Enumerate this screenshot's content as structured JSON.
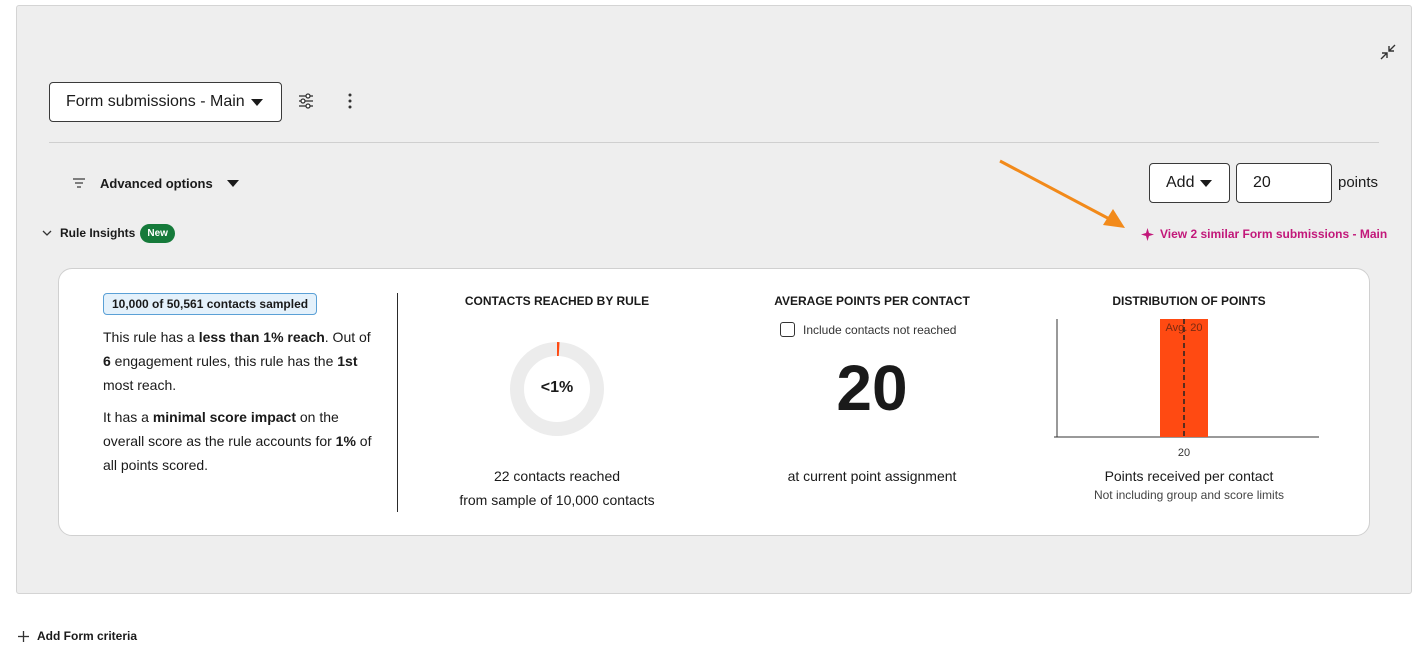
{
  "toolbar": {
    "rule_name": "Form submissions - Main"
  },
  "options": {
    "advanced_label": "Advanced options",
    "add_label": "Add",
    "points_value": "20",
    "points_label": "points"
  },
  "insights": {
    "toggle_label": "Rule Insights",
    "new_badge": "New",
    "similar_link": "View 2 similar Form submissions - Main"
  },
  "card": {
    "sampled_badge": "10,000 of 50,561 contacts sampled",
    "summary": {
      "p1_a": "This rule has a ",
      "p1_b": "less than 1% reach",
      "p1_c": ". Out of ",
      "p1_d": "6",
      "p1_e": " engagement rules, this rule has the ",
      "p1_f": "1st",
      "p1_g": " most reach.",
      "p2_a": "It has a ",
      "p2_b": "minimal score impact",
      "p2_c": " on the overall score as the rule accounts for ",
      "p2_d": "1%",
      "p2_e": " of all points scored."
    },
    "reach": {
      "title": "CONTACTS REACHED BY RULE",
      "donut_label": "<1%",
      "reach_fraction": 0.0022,
      "line1": "22 contacts reached",
      "line2": "from sample of 10,000 contacts"
    },
    "average": {
      "title": "AVERAGE POINTS PER CONTACT",
      "checkbox_label": "Include contacts not reached",
      "checkbox_checked": false,
      "value": "20",
      "subtitle": "at current point assignment"
    },
    "distribution": {
      "title": "DISTRIBUTION OF POINTS",
      "xlabel": "Points received per contact",
      "note": "Not including group and score limits"
    }
  },
  "chart_data": {
    "type": "bar",
    "categories": [
      "20"
    ],
    "values": [
      22
    ],
    "avg_label": "Avg. 20",
    "avg_x": "20",
    "xlabel": "Points received per contact",
    "bar_color": "#ff4a12"
  },
  "footer": {
    "add_criteria": "Add Form criteria"
  },
  "colors": {
    "accent": "#c2187a",
    "badge_new": "#157a3a",
    "arrow": "#f28a1a",
    "donut_track": "#ececec",
    "donut_fill": "#ff4a12"
  },
  "icons": {
    "collapse": "collapse-icon",
    "filter": "sliders-icon",
    "kebab": "more-vertical-icon",
    "lines": "filter-lines-icon",
    "chevron": "chevron-down-icon",
    "sparkle": "sparkle-icon",
    "plus": "plus-icon"
  }
}
